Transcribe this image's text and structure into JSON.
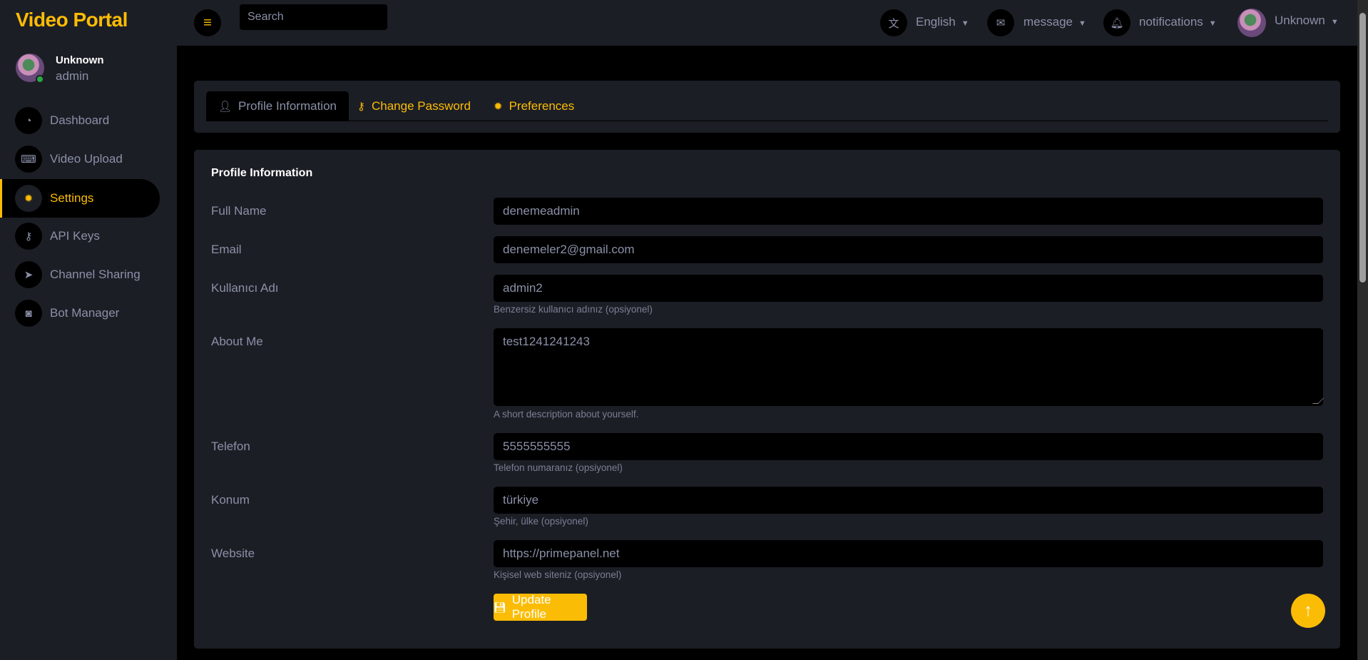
{
  "app": {
    "title": "Video Portal"
  },
  "user": {
    "name": "Unknown",
    "role": "admin"
  },
  "sidebar": {
    "items": [
      {
        "label": "Dashboard",
        "icon": "gauge-icon"
      },
      {
        "label": "Video Upload",
        "icon": "keyboard-icon"
      },
      {
        "label": "Settings",
        "icon": "gear-icon",
        "active": true
      },
      {
        "label": "API Keys",
        "icon": "key-icon"
      },
      {
        "label": "Channel Sharing",
        "icon": "telegram-icon"
      },
      {
        "label": "Bot Manager",
        "icon": "robot-icon"
      }
    ]
  },
  "header": {
    "search_placeholder": "Search",
    "language": "English",
    "message": "message",
    "notifications": "notifications",
    "user": "Unknown"
  },
  "tabs": [
    {
      "label": "Profile Information"
    },
    {
      "label": "Change Password"
    },
    {
      "label": "Preferences"
    }
  ],
  "form": {
    "title": "Profile Information",
    "fields": [
      {
        "label": "Full Name",
        "value": "denemeadmin"
      },
      {
        "label": "Email",
        "value": "denemeler2@gmail.com"
      },
      {
        "label": "Kullanıcı Adı",
        "value": "admin2",
        "help": "Benzersiz kullanıcı adınız (opsiyonel)"
      },
      {
        "label": "About Me",
        "value": "test1241241243",
        "help": "A short description about yourself."
      },
      {
        "label": "Telefon",
        "value": "5555555555",
        "help": "Telefon numaranız (opsiyonel)"
      },
      {
        "label": "Konum",
        "value": "türkiye",
        "help": "Şehir, ülke (opsiyonel)"
      },
      {
        "label": "Website",
        "value": "https://primepanel.net",
        "help": "Kişisel web siteniz (opsiyonel)"
      }
    ],
    "submit": "Update Profile"
  },
  "colors": {
    "accent": "#fbbc05",
    "panel": "#1c1e25",
    "background": "#000000"
  }
}
